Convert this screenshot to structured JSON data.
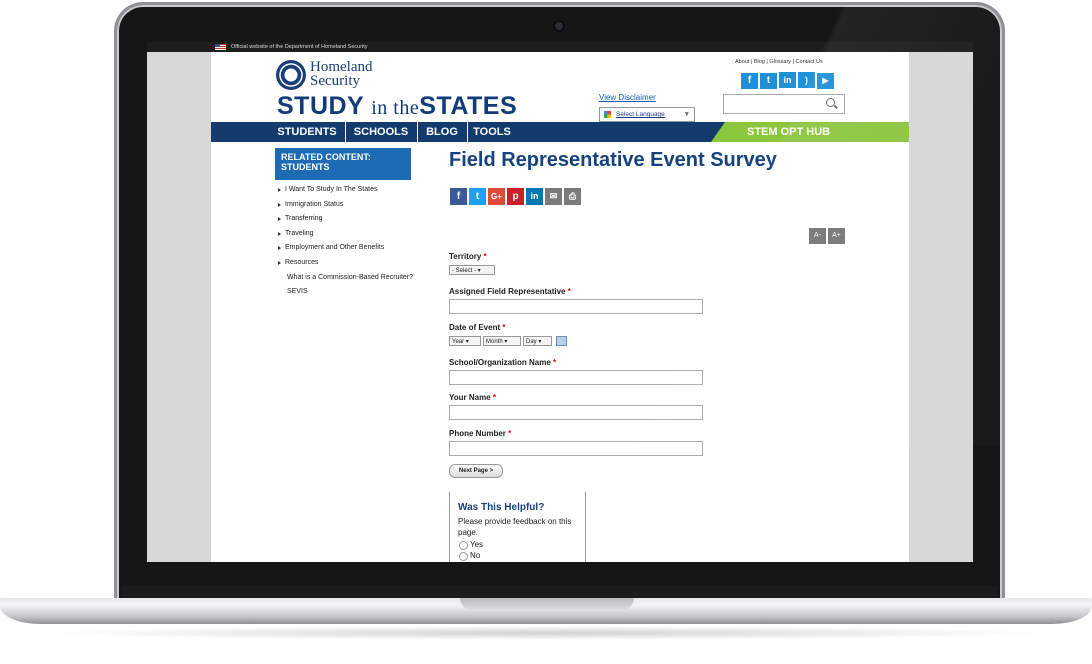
{
  "gov_banner": "Official website of the Department of Homeland Security",
  "dhs": {
    "line1": "Homeland",
    "line2": "Security"
  },
  "logo": {
    "part1": "STUDY",
    "part2": "in the",
    "part3": "STATES"
  },
  "header": {
    "disclaimer": "View Disclaimer",
    "language": "Select Language",
    "language_caret": "▼",
    "top_links": "About | Blog | Glossary | Contact Us",
    "social": [
      "f",
      "t",
      "in",
      "rss",
      "yt"
    ]
  },
  "nav": {
    "items": [
      "STUDENTS",
      "SCHOOLS",
      "BLOG",
      "TOOLS"
    ],
    "highlight": "STEM OPT HUB"
  },
  "sidebar": {
    "heading": "RELATED CONTENT: STUDENTS",
    "items": [
      "I Want To Study In The States",
      "Immigration Status",
      "Transferring",
      "Traveling",
      "Employment and Other Benefits",
      "Resources"
    ],
    "subitems": [
      "What is a Commission-Based Recruiter?",
      "SEVIS"
    ]
  },
  "main": {
    "title": "Field Representative Event Survey",
    "font_smaller": "A-",
    "font_larger": "A+",
    "territory_label": "Territory",
    "territory_value": "- Select -",
    "rep_label": "Assigned Field Representative",
    "date_label": "Date of Event",
    "year": "Year",
    "month": "Month",
    "day": "Day",
    "school_label": "School/Organization Name",
    "name_label": "Your Name",
    "phone_label": "Phone Number",
    "next_button": "Next Page >",
    "required_mark": "*"
  },
  "feedback": {
    "title": "Was This Helpful?",
    "prompt": "Please provide feedback on this page.",
    "yes": "Yes",
    "no": "No"
  },
  "colors": {
    "navy": "#143b6e",
    "title_blue": "#16427d",
    "sidebar_blue": "#1e6bb5",
    "green": "#8cc63f",
    "twitter_blue": "#1e90d6"
  }
}
